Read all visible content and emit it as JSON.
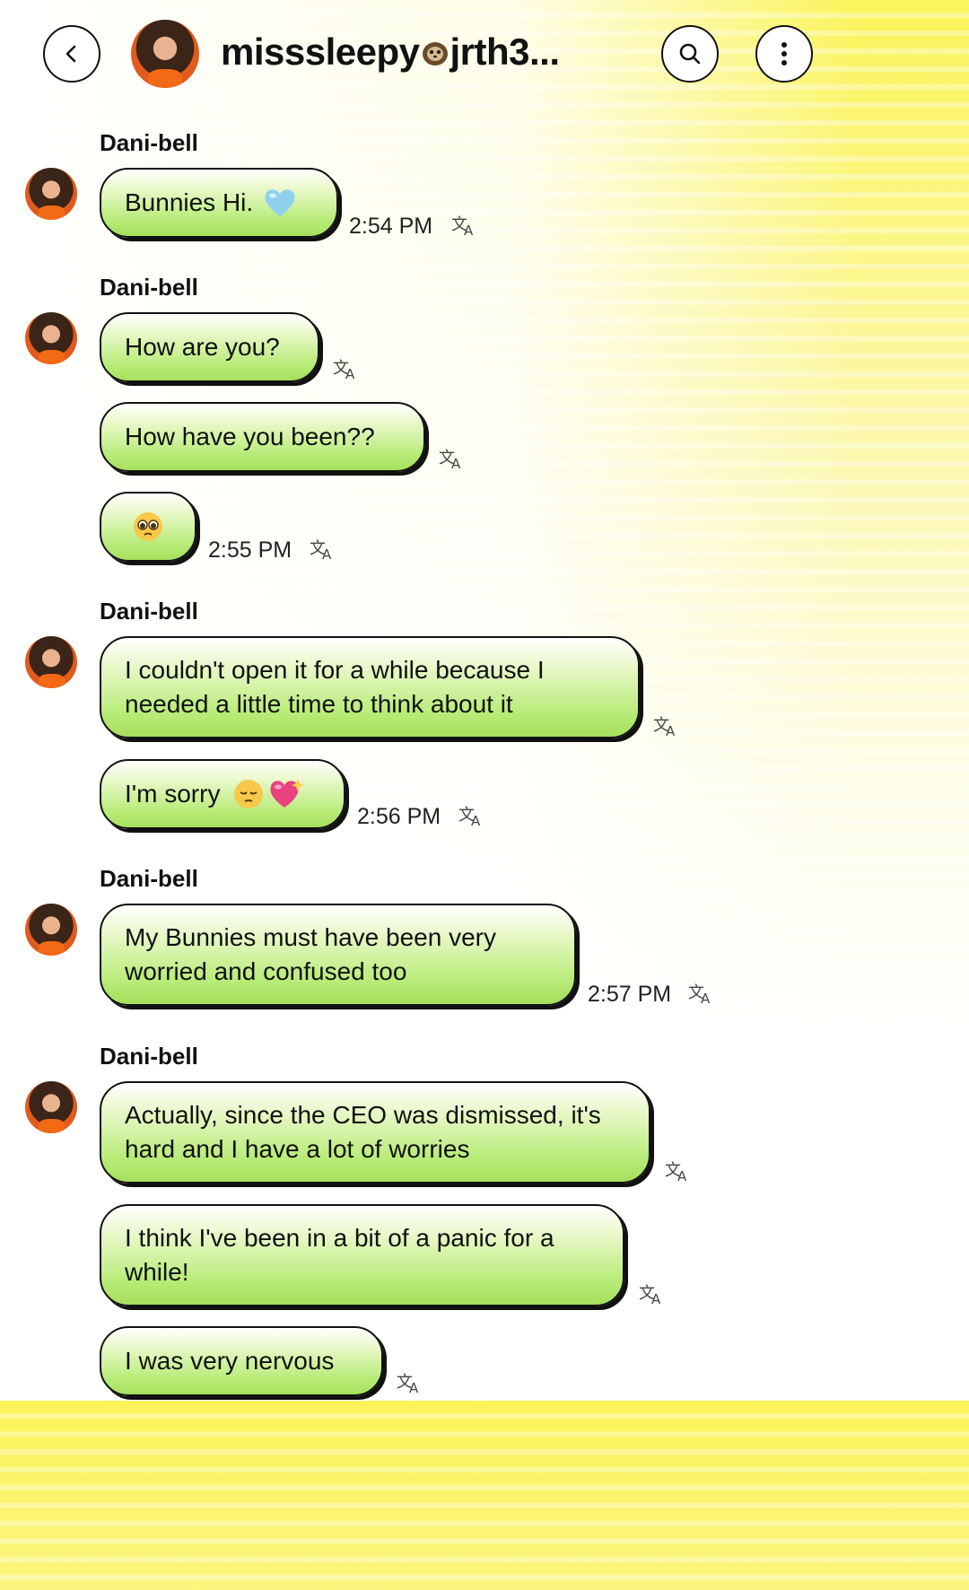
{
  "header": {
    "title_prefix": "misssleepy",
    "title_suffix": "jrth3...",
    "icons": [
      "back-icon",
      "search-icon",
      "more-icon"
    ]
  },
  "messages": [
    {
      "sender": "Dani-bell",
      "bubbles": [
        {
          "text": "Bunnies Hi.",
          "emoji": "light-blue-heart",
          "time": "2:54 PM"
        }
      ]
    },
    {
      "sender": "Dani-bell",
      "bubbles": [
        {
          "text": "How are you?"
        },
        {
          "text": "How have you been??"
        },
        {
          "text": "",
          "emoji": "pleading-face",
          "time": "2:55 PM"
        }
      ]
    },
    {
      "sender": "Dani-bell",
      "bubbles": [
        {
          "text": "I couldn't open it for a while because I needed a little time to think about it"
        },
        {
          "text": "I'm sorry",
          "emoji": "pensive-face sparkling-heart",
          "time": "2:56 PM"
        }
      ]
    },
    {
      "sender": "Dani-bell",
      "bubbles": [
        {
          "text": "My Bunnies must have been very worried and confused too",
          "time": "2:57 PM"
        }
      ]
    },
    {
      "sender": "Dani-bell",
      "bubbles": [
        {
          "text": "Actually, since the CEO was dismissed, it's hard and I have a lot of worries"
        },
        {
          "text": "I think I've been in a bit of a panic for a while!"
        },
        {
          "text": "I was very nervous"
        }
      ]
    }
  ],
  "colors": {
    "bubble_green": "#a6e05c",
    "header_yellow": "#fbf45a"
  }
}
